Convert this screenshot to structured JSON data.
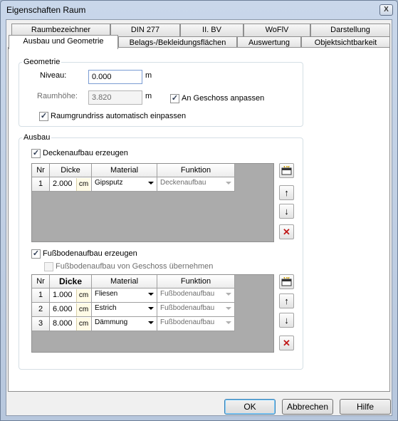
{
  "window": {
    "title": "Eigenschaften Raum",
    "close_glyph": "X"
  },
  "tabs_row1": [
    "Raumbezeichner",
    "DIN 277",
    "II. BV",
    "WoFlV",
    "Darstellung"
  ],
  "tabs_row2": [
    "Ausbau und Geometrie",
    "Belags-/Bekleidungsflächen",
    "Auswertung",
    "Objektsichtbarkeit"
  ],
  "geometrie": {
    "group_label": "Geometrie",
    "niveau_label": "Niveau:",
    "niveau_value": "0.000",
    "niveau_unit": "m",
    "raumhoehe_label": "Raumhöhe:",
    "raumhoehe_value": "3.820",
    "raumhoehe_unit": "m",
    "an_geschoss_label": "An Geschoss anpassen",
    "raumgrundriss_label": "Raumgrundriss automatisch einpassen"
  },
  "ausbau": {
    "group_label": "Ausbau",
    "decke_label": "Deckenaufbau erzeugen",
    "fussboden_label": "Fußbodenaufbau erzeugen",
    "fussboden_geschoss_label": "Fußbodenaufbau von Geschoss übernehmen",
    "columns": [
      "Nr",
      "Dicke",
      "Material",
      "Funktion"
    ],
    "decke_rows": [
      {
        "nr": "1",
        "dicke": "2.000",
        "unit": "cm",
        "material": "Gipsputz",
        "funktion": "Deckenaufbau"
      }
    ],
    "fussboden_rows": [
      {
        "nr": "1",
        "dicke": "1.000",
        "unit": "cm",
        "material": "Fliesen",
        "funktion": "Fußbodenaufbau"
      },
      {
        "nr": "2",
        "dicke": "6.000",
        "unit": "cm",
        "material": "Estrich",
        "funktion": "Fußbodenaufbau"
      },
      {
        "nr": "3",
        "dicke": "8.000",
        "unit": "cm",
        "material": "Dämmung",
        "funktion": "Fußbodenaufbau"
      }
    ],
    "side_buttons": {
      "up": "↑",
      "down": "↓",
      "delete": "✕"
    }
  },
  "check_glyph": "✓",
  "buttons": {
    "ok": "OK",
    "cancel": "Abbrechen",
    "help": "Hilfe"
  },
  "colors": {
    "delete_red": "#c01818",
    "accent_blue": "#3c7fb1"
  }
}
